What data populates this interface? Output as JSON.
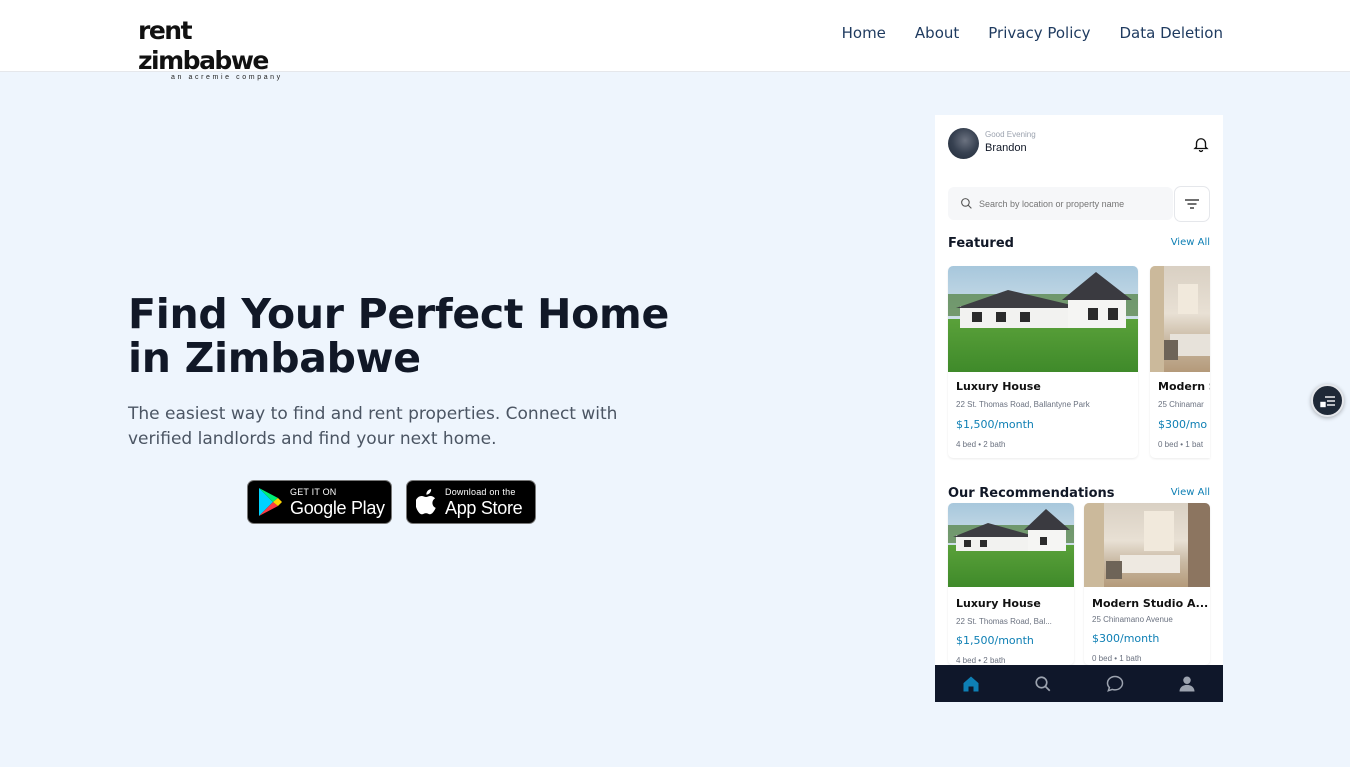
{
  "header": {
    "logo_main": "rent zimbabwe",
    "logo_sub": "an acremie company",
    "nav": [
      "Home",
      "About",
      "Privacy Policy",
      "Data Deletion"
    ]
  },
  "hero": {
    "title_line1": "Find Your Perfect Home",
    "title_line2": "in Zimbabwe",
    "description": "The easiest way to find and rent properties. Connect with verified landlords and find your next home.",
    "google_play": {
      "small": "GET IT ON",
      "big": "Google Play"
    },
    "app_store": {
      "small": "Download on the",
      "big": "App Store"
    }
  },
  "app": {
    "greeting": "Good Evening",
    "user_name": "Brandon",
    "search_placeholder": "Search by location or property name",
    "featured": {
      "title": "Featured",
      "view_all": "View All",
      "cards": [
        {
          "title": "Luxury House",
          "address": "22 St. Thomas Road, Ballantyne Park",
          "price": "$1,500/month",
          "meta": "4 bed • 2 bath"
        },
        {
          "title": "Modern S",
          "address": "25 Chinamar",
          "price": "$300/mo",
          "meta": "0 bed • 1 bat"
        }
      ]
    },
    "recommendations": {
      "title": "Our Recommendations",
      "view_all": "View All",
      "cards": [
        {
          "title": "Luxury House",
          "address": "22 St. Thomas Road, Bal...",
          "price": "$1,500/month",
          "meta": "4 bed • 2 bath"
        },
        {
          "title": "Modern Studio A...",
          "address": "25 Chinamano Avenue",
          "price": "$300/month",
          "meta": "0 bed • 1 bath"
        }
      ]
    },
    "bottom_nav": [
      "home-icon",
      "search-icon",
      "chat-icon",
      "profile-icon"
    ],
    "accent": "#0e7fb4",
    "nav_bg": "#0f172a"
  }
}
